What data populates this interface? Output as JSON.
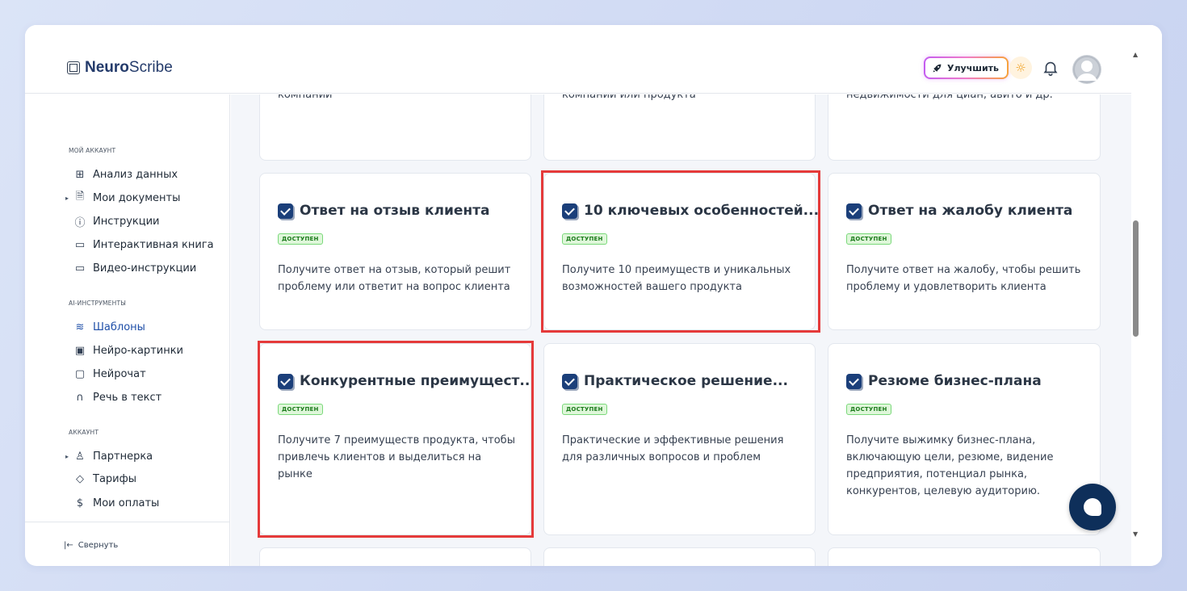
{
  "header": {
    "logo_bold": "Neuro",
    "logo_rest": "Scribe",
    "upgrade_label": "Улучшить"
  },
  "sidebar": {
    "sections": [
      {
        "label": "МОЙ АККАУНТ"
      },
      {
        "label": "AI-ИНСТРУМЕНТЫ"
      },
      {
        "label": "АККАУНТ"
      }
    ],
    "items": [
      {
        "label": "Анализ данных",
        "icon": "grid-icon"
      },
      {
        "label": "Мои документы",
        "icon": "document-icon"
      },
      {
        "label": "Инструкции",
        "icon": "question-icon"
      },
      {
        "label": "Интерактивная книга",
        "icon": "book-icon"
      },
      {
        "label": "Видео-инструкции",
        "icon": "video-icon"
      },
      {
        "label": "Шаблоны",
        "icon": "layers-icon"
      },
      {
        "label": "Нейро-картинки",
        "icon": "image-icon"
      },
      {
        "label": "Нейрочат",
        "icon": "chat-icon"
      },
      {
        "label": "Речь в текст",
        "icon": "headphones-icon"
      },
      {
        "label": "Партнерка",
        "icon": "users-icon"
      },
      {
        "label": "Тарифы",
        "icon": "tag-icon"
      },
      {
        "label": "Мои оплаты",
        "icon": "dollar-icon"
      }
    ],
    "collapse_label": "Свернуть"
  },
  "top_cut_texts": [
    "компании",
    "компании или продукта",
    "недвижимости для циан, авито и др."
  ],
  "cards": [
    {
      "title": "Ответ на отзыв клиента",
      "badge": "ДОСТУПЕН",
      "desc": "Получите ответ на отзыв, который решит проблему или ответит на вопрос клиента"
    },
    {
      "title": "10 ключевых особенностей...",
      "badge": "ДОСТУПЕН",
      "desc": "Получите 10 преимуществ и уникальных возможностей вашего продукта"
    },
    {
      "title": "Ответ на жалобу клиента",
      "badge": "ДОСТУПЕН",
      "desc": "Получите ответ на жалобу, чтобы решить проблему и удовлетворить клиента"
    },
    {
      "title": "Конкурентные преимущест...",
      "badge": "ДОСТУПЕН",
      "desc": "Получите 7 преимуществ продукта, чтобы привлечь клиентов и выделиться на рынке"
    },
    {
      "title": "Практическое решение...",
      "badge": "ДОСТУПЕН",
      "desc": "Практические и эффективные решения для различных вопросов и проблем"
    },
    {
      "title": "Резюме бизнес-плана",
      "badge": "ДОСТУПЕН",
      "desc": "Получите выжимку бизнес-плана, включающую цели, резюме, видение предприятия, потенциал рынка, конкурентов, целевую аудиторию."
    }
  ],
  "colors": {
    "highlight": "#e53a3a",
    "active_nav": "#1f4fa8",
    "badge_green": "#1a7a1a"
  }
}
